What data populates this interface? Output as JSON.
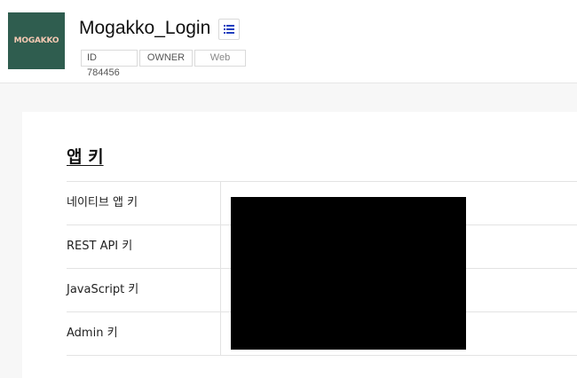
{
  "app": {
    "logo_text": "MOGAKKO",
    "logo_bg": "#2f5d4f",
    "title": "Mogakko_Login",
    "menu_icon": "list-icon",
    "tags": {
      "id": "ID 784456",
      "role": "OWNER",
      "platform": "Web"
    }
  },
  "section": {
    "title": "앱 키",
    "rows": [
      {
        "label": "네이티브 앱 키"
      },
      {
        "label": "REST API 키"
      },
      {
        "label": "JavaScript 키"
      },
      {
        "label": "Admin 키"
      }
    ]
  }
}
